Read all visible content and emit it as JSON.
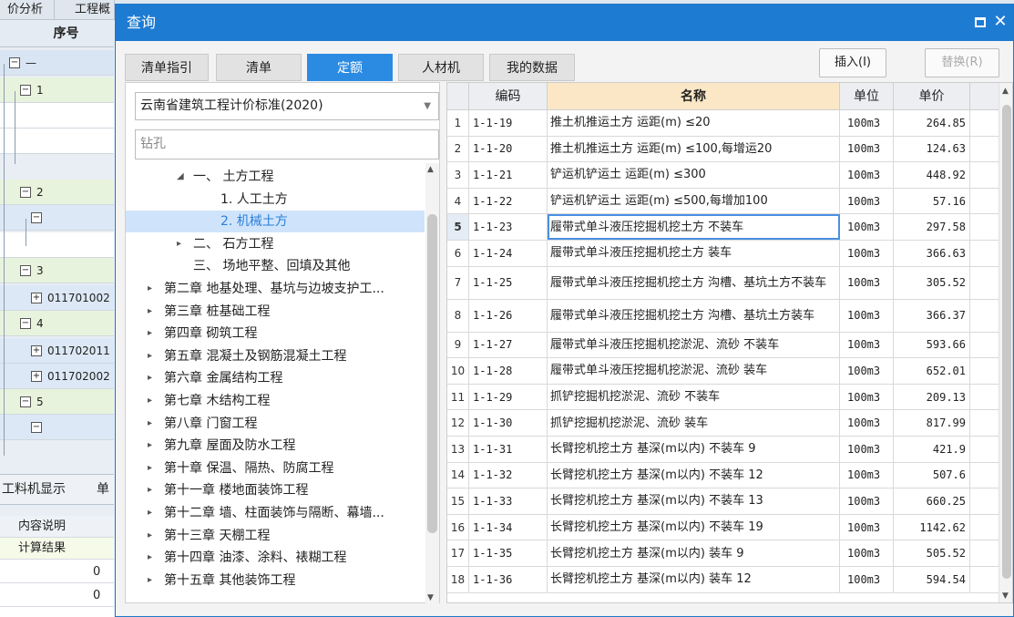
{
  "background_app": {
    "tabs": [
      "价分析",
      "工程概"
    ],
    "grid_header": "序号",
    "tree_rows": [
      {
        "label": "—",
        "box": "−"
      },
      {
        "label": "1",
        "box": "−"
      },
      {
        "label": "",
        "box": ""
      },
      {
        "label": "",
        "box": ""
      },
      {
        "label": "2",
        "box": "−"
      },
      {
        "label": "",
        "box": "−"
      },
      {
        "label": "",
        "box": ""
      },
      {
        "label": "3",
        "box": "−"
      },
      {
        "label": "011701002",
        "box": "+"
      },
      {
        "label": "4",
        "box": "−"
      },
      {
        "label": "011702011",
        "box": "+"
      },
      {
        "label": "011702002",
        "box": "+"
      },
      {
        "label": "5",
        "box": "−"
      },
      {
        "label": "",
        "box": "−"
      }
    ],
    "panel_tabs": [
      "工料机显示",
      "单"
    ],
    "props_header": "内容说明",
    "props_rows": [
      {
        "label": "计算结果",
        "value": ""
      },
      {
        "label": "",
        "value": "0"
      },
      {
        "label": "",
        "value": "0"
      }
    ]
  },
  "dialog": {
    "title": "查询",
    "tabs": [
      {
        "label": "清单指引",
        "active": false
      },
      {
        "label": "清单",
        "active": false
      },
      {
        "label": "定额",
        "active": true
      },
      {
        "label": "人材机",
        "active": false
      },
      {
        "label": "我的数据",
        "active": false
      }
    ],
    "insert_button": "插入(I)",
    "replace_button": "替换(R)",
    "standard_select": "云南省建筑工程计价标准(2020)",
    "search_value": "钻孔",
    "tree": [
      {
        "label": "一、 土方工程",
        "arrow": "◢",
        "level": 1,
        "selected": false
      },
      {
        "label": "1. 人工土方",
        "arrow": "",
        "level": 2,
        "selected": false
      },
      {
        "label": "2. 机械土方",
        "arrow": "",
        "level": 2,
        "selected": true
      },
      {
        "label": "二、 石方工程",
        "arrow": "▸",
        "level": 1,
        "selected": false
      },
      {
        "label": "三、 场地平整、回填及其他",
        "arrow": "",
        "level": 1,
        "selected": false
      },
      {
        "label": "第二章 地基处理、基坑与边坡支护工...",
        "arrow": "▸",
        "level": 0,
        "selected": false
      },
      {
        "label": "第三章 桩基础工程",
        "arrow": "▸",
        "level": 0,
        "selected": false
      },
      {
        "label": "第四章 砌筑工程",
        "arrow": "▸",
        "level": 0,
        "selected": false
      },
      {
        "label": "第五章 混凝土及钢筋混凝土工程",
        "arrow": "▸",
        "level": 0,
        "selected": false
      },
      {
        "label": "第六章 金属结构工程",
        "arrow": "▸",
        "level": 0,
        "selected": false
      },
      {
        "label": "第七章 木结构工程",
        "arrow": "▸",
        "level": 0,
        "selected": false
      },
      {
        "label": "第八章 门窗工程",
        "arrow": "▸",
        "level": 0,
        "selected": false
      },
      {
        "label": "第九章 屋面及防水工程",
        "arrow": "▸",
        "level": 0,
        "selected": false
      },
      {
        "label": "第十章 保温、隔热、防腐工程",
        "arrow": "▸",
        "level": 0,
        "selected": false
      },
      {
        "label": "第十一章 楼地面装饰工程",
        "arrow": "▸",
        "level": 0,
        "selected": false
      },
      {
        "label": "第十二章 墙、柱面装饰与隔断、幕墙...",
        "arrow": "▸",
        "level": 0,
        "selected": false
      },
      {
        "label": "第十三章 天棚工程",
        "arrow": "▸",
        "level": 0,
        "selected": false
      },
      {
        "label": "第十四章 油漆、涂料、裱糊工程",
        "arrow": "▸",
        "level": 0,
        "selected": false
      },
      {
        "label": "第十五章 其他装饰工程",
        "arrow": "▸",
        "level": 0,
        "selected": false
      }
    ],
    "grid": {
      "columns": [
        "",
        "编码",
        "名称",
        "单位",
        "单价"
      ],
      "current_row": 5,
      "rows": [
        {
          "n": "1",
          "code": "1-1-19",
          "name": "推土机推运土方 运距(m) ≤20",
          "unit": "100m3",
          "price": "264.85"
        },
        {
          "n": "2",
          "code": "1-1-20",
          "name": "推土机推运土方 运距(m) ≤100,每增运20",
          "unit": "100m3",
          "price": "124.63"
        },
        {
          "n": "3",
          "code": "1-1-21",
          "name": "铲运机铲运土 运距(m) ≤300",
          "unit": "100m3",
          "price": "448.92"
        },
        {
          "n": "4",
          "code": "1-1-22",
          "name": "铲运机铲运土 运距(m) ≤500,每增加100",
          "unit": "100m3",
          "price": "57.16"
        },
        {
          "n": "5",
          "code": "1-1-23",
          "name": "履带式单斗液压挖掘机挖土方 不装车",
          "unit": "100m3",
          "price": "297.58"
        },
        {
          "n": "6",
          "code": "1-1-24",
          "name": "履带式单斗液压挖掘机挖土方 装车",
          "unit": "100m3",
          "price": "366.63"
        },
        {
          "n": "7",
          "code": "1-1-25",
          "name": "履带式单斗液压挖掘机挖土方 沟槽、基坑土方不装车",
          "unit": "100m3",
          "price": "305.52"
        },
        {
          "n": "8",
          "code": "1-1-26",
          "name": "履带式单斗液压挖掘机挖土方 沟槽、基坑土方装车",
          "unit": "100m3",
          "price": "366.37"
        },
        {
          "n": "9",
          "code": "1-1-27",
          "name": "履带式单斗液压挖掘机挖淤泥、流砂 不装车",
          "unit": "100m3",
          "price": "593.66"
        },
        {
          "n": "10",
          "code": "1-1-28",
          "name": "履带式单斗液压挖掘机挖淤泥、流砂 装车",
          "unit": "100m3",
          "price": "652.01"
        },
        {
          "n": "11",
          "code": "1-1-29",
          "name": "抓铲挖掘机挖淤泥、流砂 不装车",
          "unit": "100m3",
          "price": "209.13"
        },
        {
          "n": "12",
          "code": "1-1-30",
          "name": "抓铲挖掘机挖淤泥、流砂 装车",
          "unit": "100m3",
          "price": "817.99"
        },
        {
          "n": "13",
          "code": "1-1-31",
          "name": "长臂挖机挖土方 基深(m以内) 不装车 9",
          "unit": "100m3",
          "price": "421.9"
        },
        {
          "n": "14",
          "code": "1-1-32",
          "name": "长臂挖机挖土方 基深(m以内) 不装车 12",
          "unit": "100m3",
          "price": "507.6"
        },
        {
          "n": "15",
          "code": "1-1-33",
          "name": "长臂挖机挖土方 基深(m以内) 不装车 13",
          "unit": "100m3",
          "price": "660.25"
        },
        {
          "n": "16",
          "code": "1-1-34",
          "name": "长臂挖机挖土方 基深(m以内) 不装车 19",
          "unit": "100m3",
          "price": "1142.62"
        },
        {
          "n": "17",
          "code": "1-1-35",
          "name": "长臂挖机挖土方 基深(m以内) 装车 9",
          "unit": "100m3",
          "price": "505.52"
        },
        {
          "n": "18",
          "code": "1-1-36",
          "name": "长臂挖机挖土方 基深(m以内) 装车 12",
          "unit": "100m3",
          "price": "594.54"
        }
      ]
    }
  }
}
